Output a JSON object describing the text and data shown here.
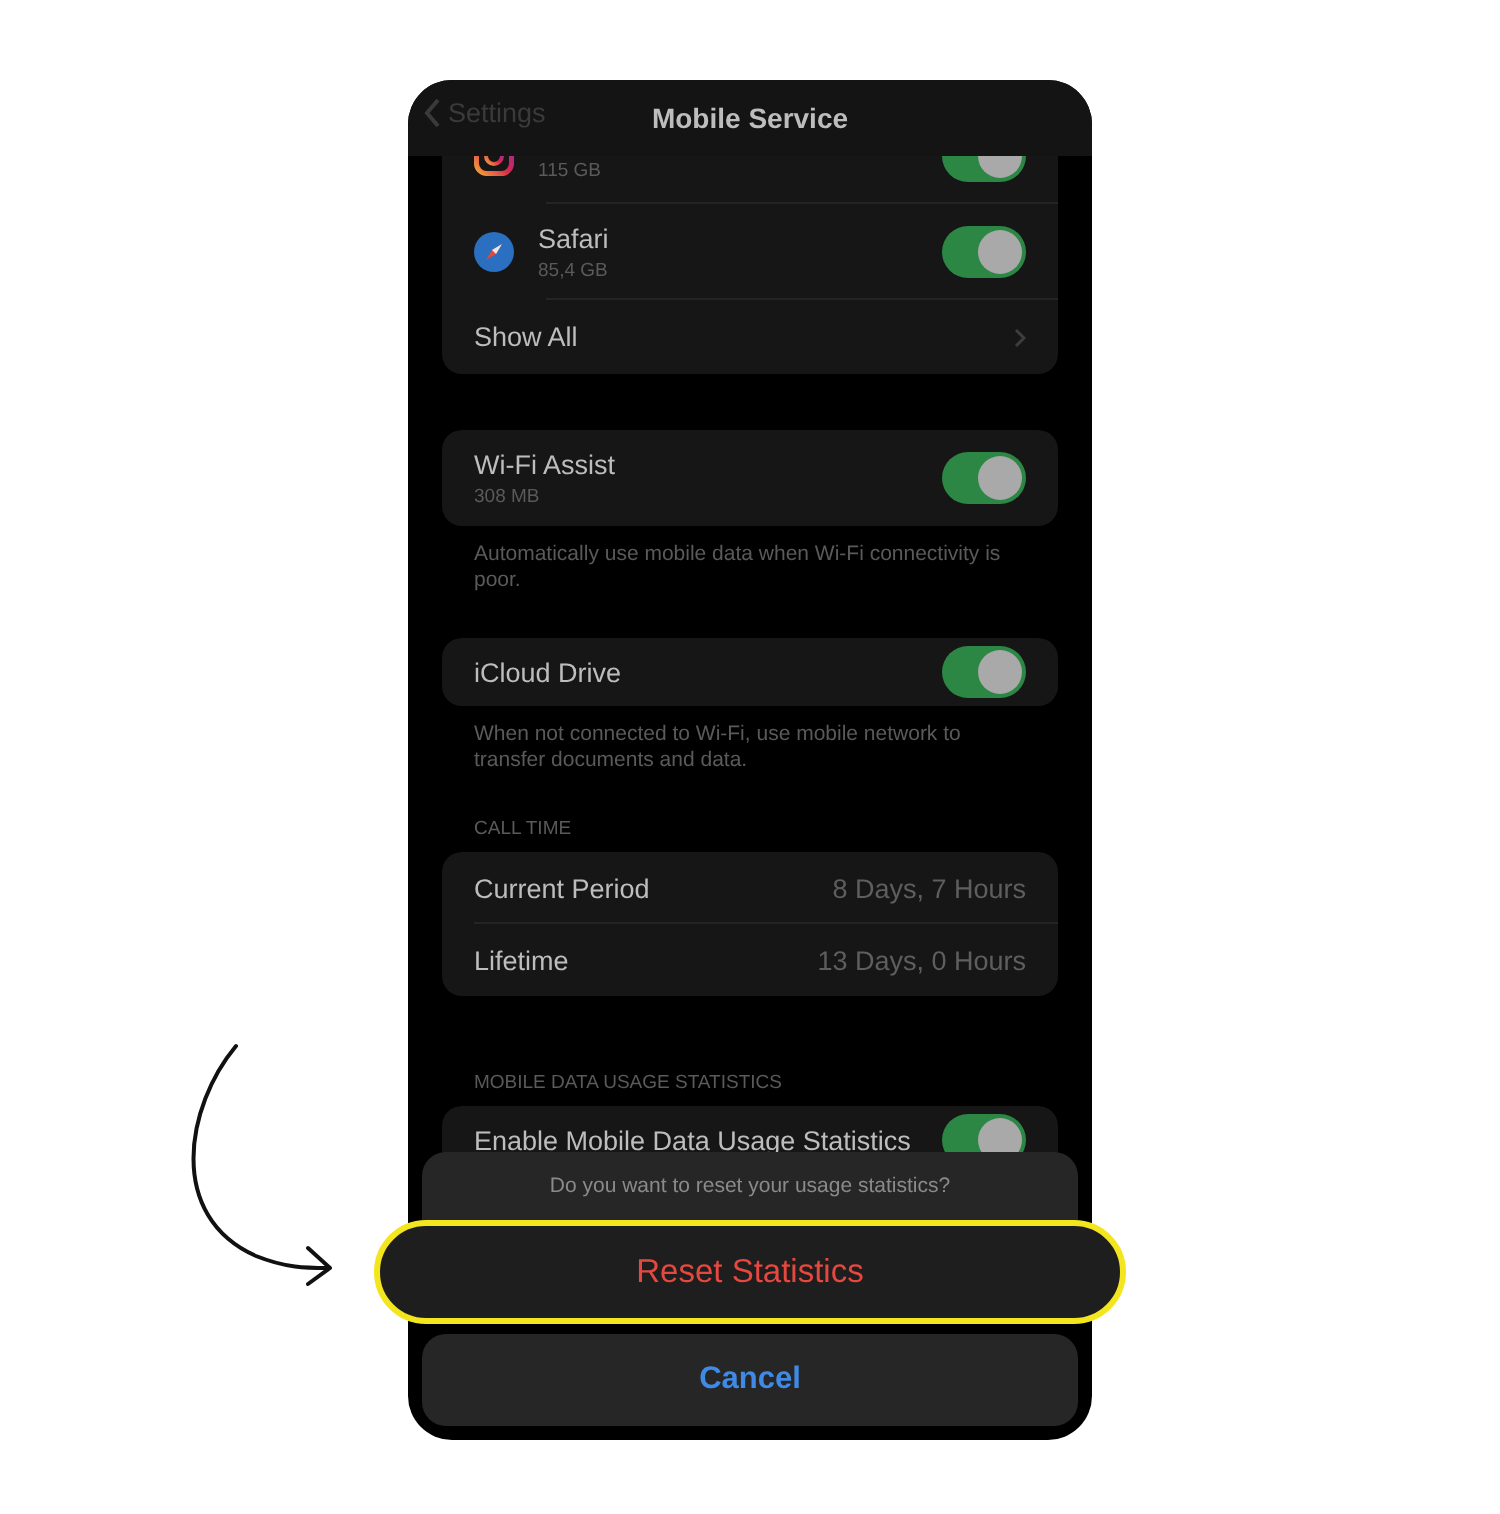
{
  "nav": {
    "back": "Settings",
    "title": "Mobile Service"
  },
  "apps": {
    "items": [
      {
        "usage": "115 GB",
        "on": true
      },
      {
        "name": "Safari",
        "usage": "85,4 GB",
        "on": true
      }
    ],
    "show_all": "Show All"
  },
  "sections": [
    {
      "kind": "toggle",
      "label": "Wi-Fi Assist",
      "detail": "308 MB",
      "on": true,
      "footer": "Automatically use mobile data when Wi-Fi connectivity is poor."
    },
    {
      "kind": "toggle",
      "label": "iCloud Drive",
      "on": true,
      "footer": "When not connected to Wi-Fi, use mobile network to transfer documents and data."
    },
    {
      "kind": "values",
      "header": "CALL TIME",
      "rows": [
        {
          "label": "Current Period",
          "value": "8 Days, 7 Hours"
        },
        {
          "label": "Lifetime",
          "value": "13 Days, 0 Hours"
        }
      ]
    },
    {
      "kind": "toggle",
      "header": "MOBILE DATA USAGE STATISTICS",
      "label": "Enable Mobile Data Usage Statistics",
      "on": true
    }
  ],
  "action_sheet": {
    "message": "Do you want to reset your usage statistics?",
    "actions": [
      {
        "label": "Reset Statistics",
        "kind": "destructive",
        "highlighted": true
      }
    ],
    "cancel": "Cancel"
  }
}
